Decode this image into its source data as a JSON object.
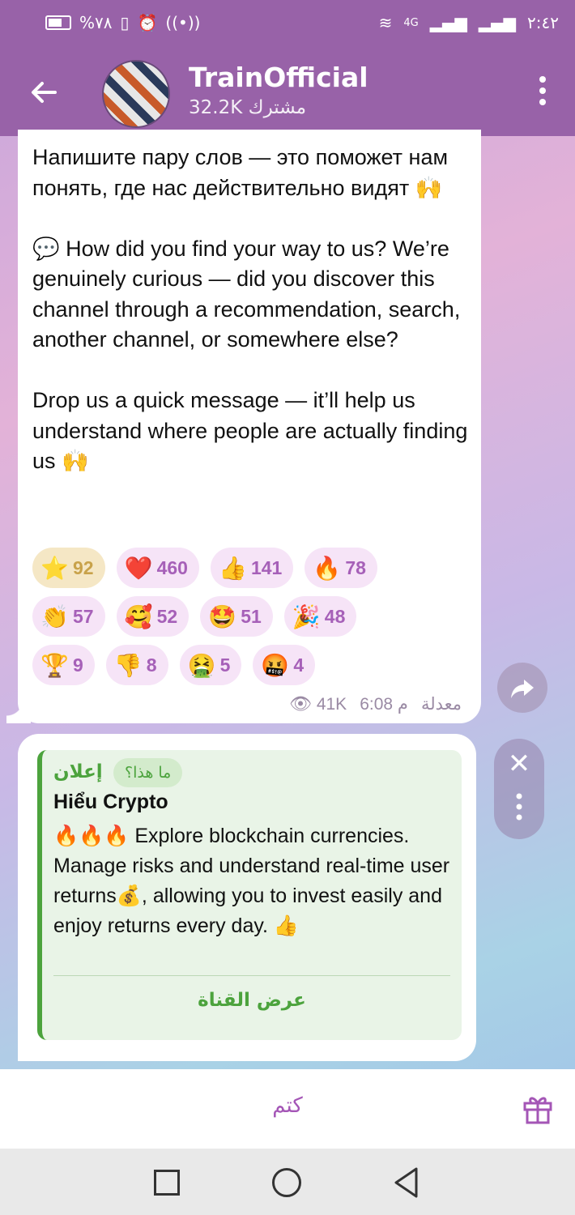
{
  "status": {
    "battery": "%٧٨",
    "time": "٢:٤٢",
    "network": "4G"
  },
  "header": {
    "channel_name": "TrainOfficial",
    "subscribers": "32.2K مشترك"
  },
  "message": {
    "text_paragraphs": [
      "Напишите пару слов — это поможет нам понять, где нас действительно видят 🙌",
      "💬 How did you find your way to us? We’re genuinely curious — did you discover this channel through a recommendation, search, another channel, or somewhere else?",
      "Drop us a quick message — it’ll help us understand where people are actually finding us 🙌"
    ],
    "reactions": [
      {
        "emoji": "⭐",
        "count": "92",
        "selected": true
      },
      {
        "emoji": "❤️",
        "count": "460"
      },
      {
        "emoji": "👍",
        "count": "141"
      },
      {
        "emoji": "🔥",
        "count": "78"
      },
      {
        "emoji": "👏",
        "count": "57"
      },
      {
        "emoji": "🥰",
        "count": "52"
      },
      {
        "emoji": "🤩",
        "count": "51"
      },
      {
        "emoji": "🎉",
        "count": "48"
      },
      {
        "emoji": "🏆",
        "count": "9"
      },
      {
        "emoji": "👎",
        "count": "8"
      },
      {
        "emoji": "🤮",
        "count": "5"
      },
      {
        "emoji": "🤬",
        "count": "4"
      }
    ],
    "views": "41K",
    "time": "6:08 م",
    "edited_label": "معدلة"
  },
  "ad": {
    "label": "إعلان",
    "what_is_this": "ما هذا؟",
    "title": "Hiểu Crypto",
    "body": "🔥🔥🔥 Explore blockchain currencies. Manage risks and understand real-time user returns💰, allowing you to invest easily and enjoy returns every day. 👍",
    "button": "عرض القناة"
  },
  "bottom": {
    "mute_label": "كتم"
  },
  "colors": {
    "header": "#9862a8",
    "accent": "#a456b6",
    "ad_green": "#4ca33d"
  },
  "icons": [
    "back-arrow-icon",
    "more-vert-icon",
    "eye-icon",
    "share-icon",
    "close-icon",
    "gift-icon"
  ]
}
